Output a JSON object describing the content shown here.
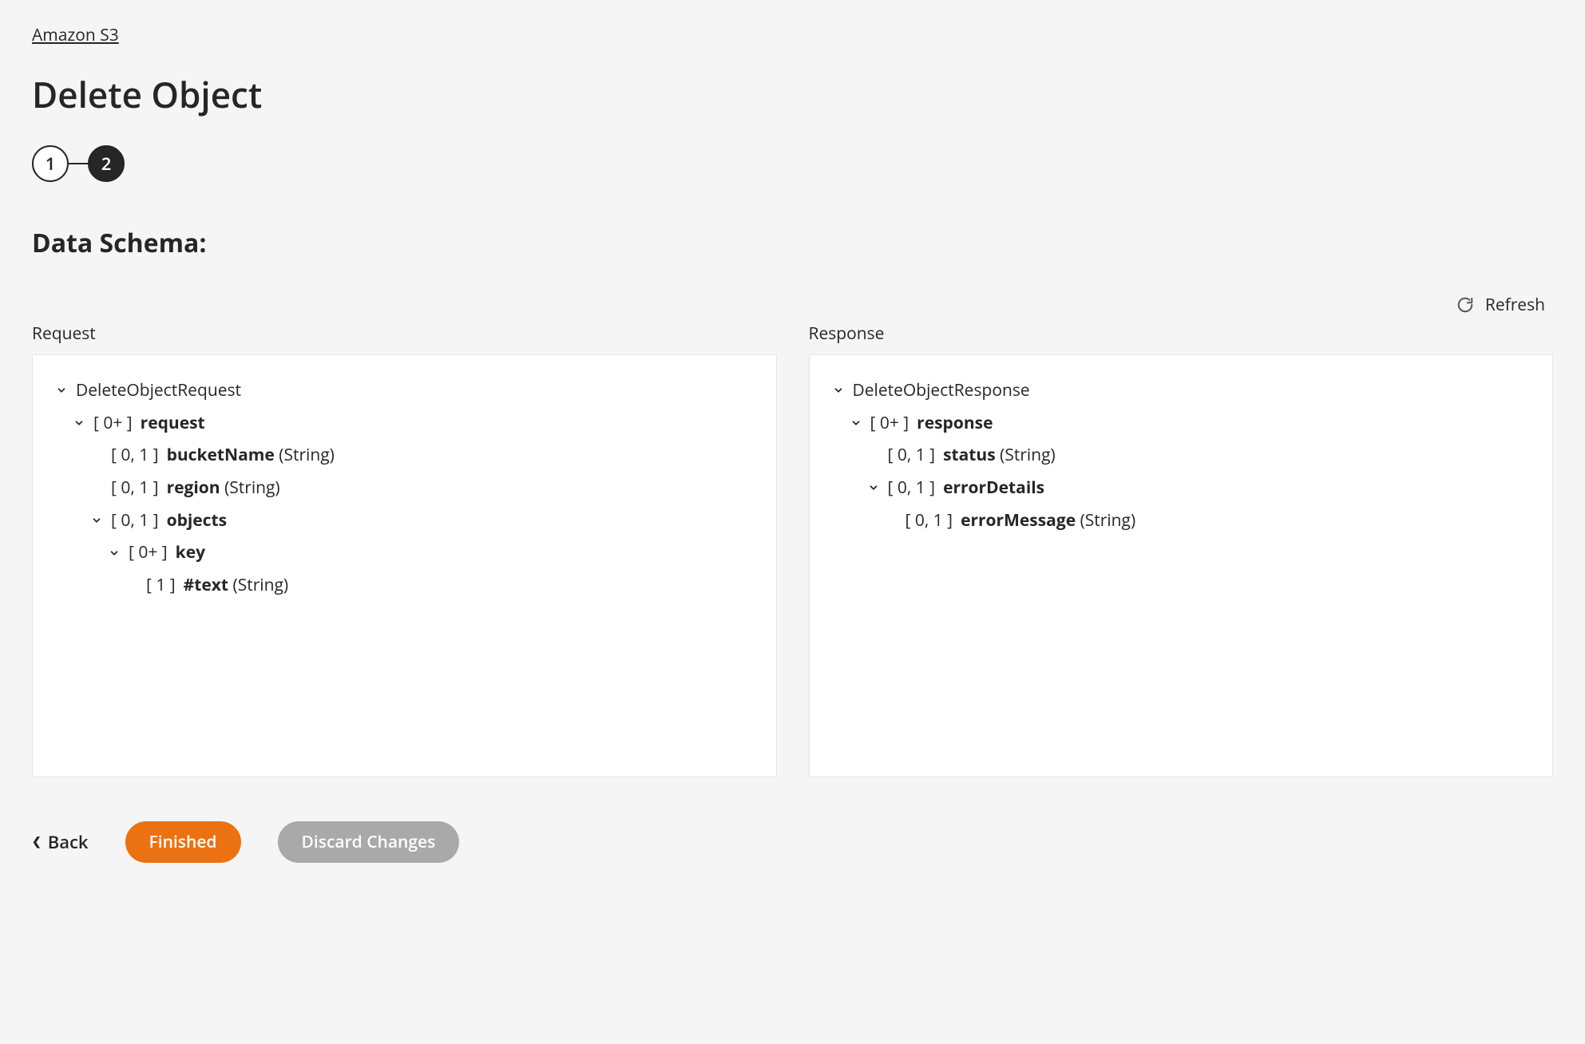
{
  "breadcrumb": "Amazon S3",
  "page_title": "Delete Object",
  "stepper": {
    "step1": "1",
    "step2": "2"
  },
  "section_title": "Data Schema:",
  "refresh_label": "Refresh",
  "panels": {
    "request": {
      "label": "Request",
      "root": "DeleteObjectRequest",
      "n_request": {
        "occ": "[ 0+ ]",
        "name": "request"
      },
      "n_bucket": {
        "occ": "[ 0, 1 ]",
        "name": "bucketName",
        "type": "(String)"
      },
      "n_region": {
        "occ": "[ 0, 1 ]",
        "name": "region",
        "type": "(String)"
      },
      "n_objects": {
        "occ": "[ 0, 1 ]",
        "name": "objects"
      },
      "n_key": {
        "occ": "[ 0+ ]",
        "name": "key"
      },
      "n_text": {
        "occ": "[ 1 ]",
        "name": "#text",
        "type": "(String)"
      }
    },
    "response": {
      "label": "Response",
      "root": "DeleteObjectResponse",
      "n_response": {
        "occ": "[ 0+ ]",
        "name": "response"
      },
      "n_status": {
        "occ": "[ 0, 1 ]",
        "name": "status",
        "type": "(String)"
      },
      "n_errdetails": {
        "occ": "[ 0, 1 ]",
        "name": "errorDetails"
      },
      "n_errmessage": {
        "occ": "[ 0, 1 ]",
        "name": "errorMessage",
        "type": "(String)"
      }
    }
  },
  "footer": {
    "back": "Back",
    "finished": "Finished",
    "discard": "Discard Changes"
  }
}
